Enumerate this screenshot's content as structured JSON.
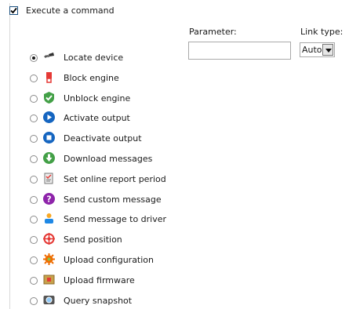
{
  "command": {
    "checkbox_checked": true,
    "title": "Execute a command",
    "parameter_label": "Parameter:",
    "parameter_value": "",
    "link_type_label": "Link type:",
    "link_type_value": "Auto",
    "selected_option": 0,
    "options": [
      {
        "label": "Locate device",
        "icon": "satellite-icon"
      },
      {
        "label": "Block engine",
        "icon": "block-engine-icon"
      },
      {
        "label": "Unblock engine",
        "icon": "unblock-engine-icon"
      },
      {
        "label": "Activate output",
        "icon": "activate-output-icon"
      },
      {
        "label": "Deactivate output",
        "icon": "deactivate-output-icon"
      },
      {
        "label": "Download messages",
        "icon": "download-icon"
      },
      {
        "label": "Set online report period",
        "icon": "report-period-icon"
      },
      {
        "label": "Send custom message",
        "icon": "custom-message-icon"
      },
      {
        "label": "Send message to driver",
        "icon": "driver-message-icon"
      },
      {
        "label": "Send position",
        "icon": "position-icon"
      },
      {
        "label": "Upload configuration",
        "icon": "configuration-icon"
      },
      {
        "label": "Upload firmware",
        "icon": "firmware-icon"
      },
      {
        "label": "Query snapshot",
        "icon": "camera-icon"
      }
    ]
  },
  "colors": {
    "accent_blue": "#1565c0",
    "red": "#e53935",
    "green": "#43a047",
    "purple": "#8e24aa",
    "orange": "#ef6c00"
  }
}
